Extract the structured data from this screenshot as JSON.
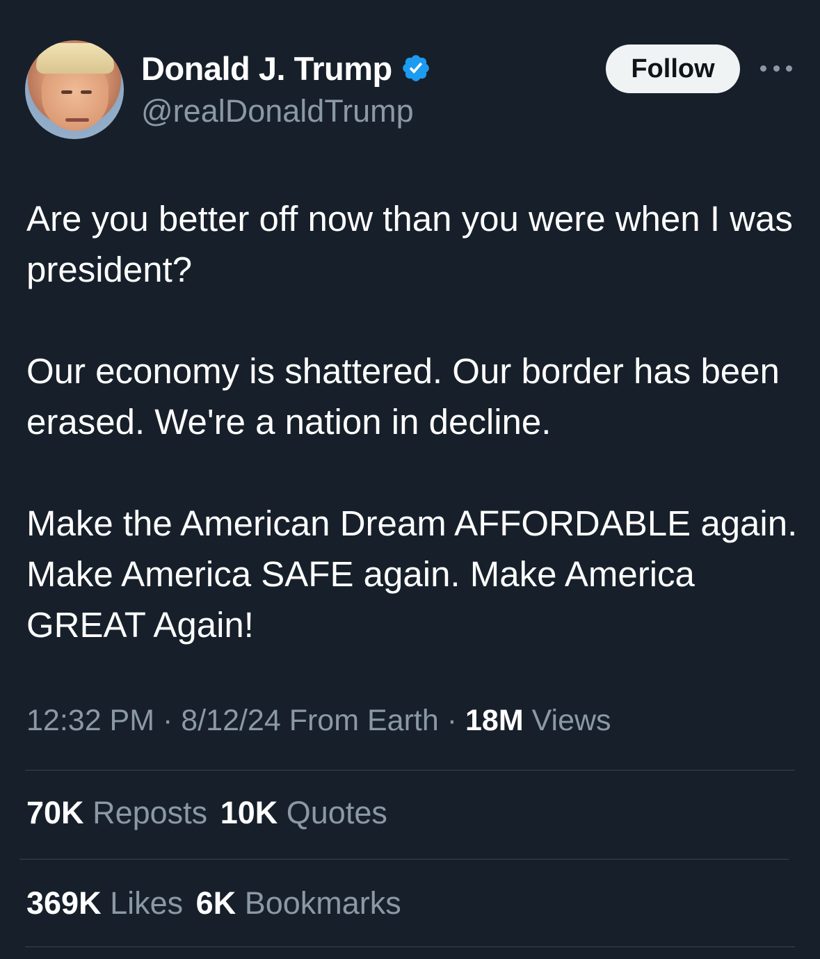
{
  "author": {
    "display_name": "Donald J. Trump",
    "handle": "@realDonaldTrump",
    "verified_color": "#1d9bf0"
  },
  "actions": {
    "follow_label": "Follow"
  },
  "tweet": {
    "paragraphs": [
      "Are you better off now than you were when I was president?",
      "Our economy is shattered. Our border has been erased. We're a nation in decline.",
      "Make the American Dream AFFORDABLE again. Make America SAFE again. Make America GREAT Again!"
    ]
  },
  "meta": {
    "time": "12:32 PM",
    "separator": "·",
    "date": "8/12/24",
    "source": "From Earth",
    "views_count": "18M",
    "views_label": "Views"
  },
  "stats": {
    "reposts_count": "70K",
    "reposts_label": "Reposts",
    "quotes_count": "10K",
    "quotes_label": "Quotes",
    "likes_count": "369K",
    "likes_label": "Likes",
    "bookmarks_count": "6K",
    "bookmarks_label": "Bookmarks"
  },
  "colors": {
    "background": "#17202a",
    "secondary_text": "#8b98a5",
    "divider": "#38444d"
  }
}
